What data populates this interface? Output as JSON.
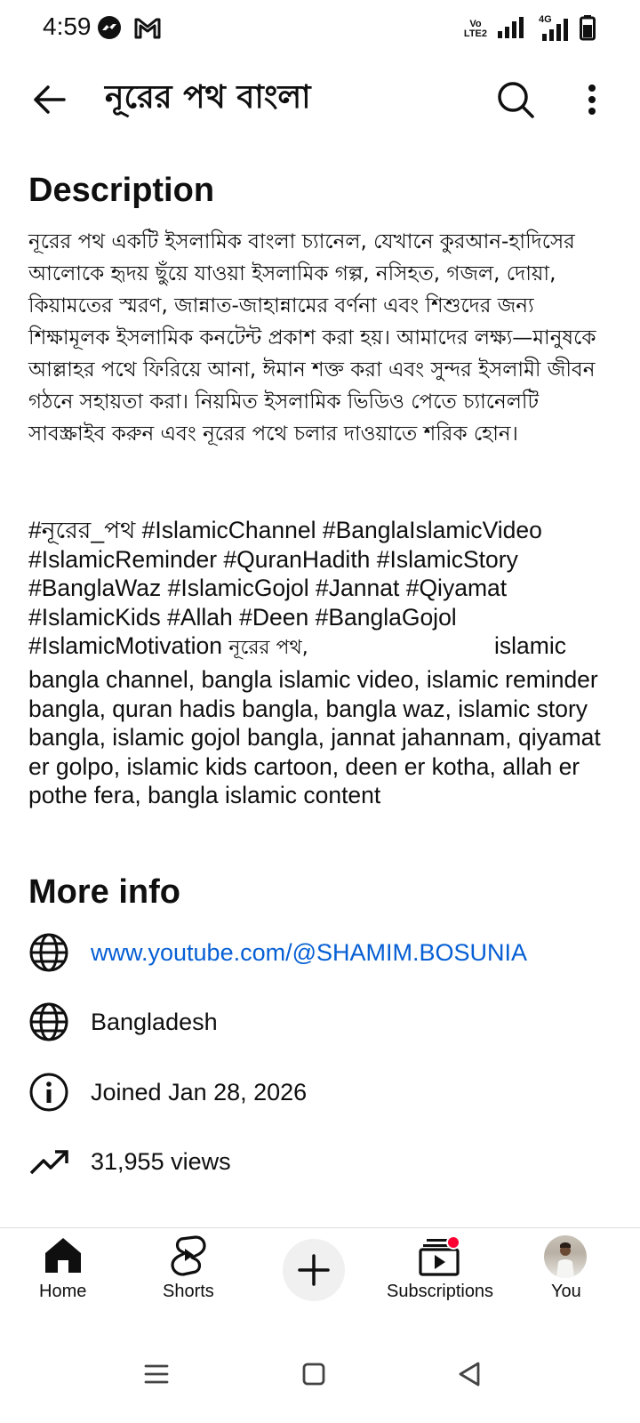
{
  "status_bar": {
    "time": "4:59",
    "volte_line1": "Vo",
    "volte_line2": "LTE2",
    "network_label": "4G"
  },
  "app_bar": {
    "title": "নূরের পথ বাংলা"
  },
  "description": {
    "heading": "Description",
    "bangla_paragraph": "নূরের পথ একটি ইসলামিক বাংলা চ্যানেল, যেখানে কুরআন-হাদিসের আলোকে হৃদয় ছুঁয়ে যাওয়া ইসলামিক গল্প, নসিহত, গজল, দোয়া, কিয়ামতের স্মরণ, জান্নাত-জাহান্নামের বর্ণনা এবং শিশুদের জন্য শিক্ষামূলক ইসলামিক কনটেন্ট প্রকাশ করা হয়। আমাদের লক্ষ্য—মানুষকে আল্লাহর পথে ফিরিয়ে আনা, ঈমান শক্ত করা এবং সুন্দর ইসলামী জীবন গঠনে সহায়তা করা। নিয়মিত ইসলামিক ভিডিও পেতে চ্যানেলটি সাবস্ক্রাইব করুন এবং নূরের পথে চলার দাওয়াতে শরিক হোন।",
    "hashtags_line1": "#নূরের_পথ #IslamicChannel #BanglaIslamicVideo",
    "hashtags_line2": "#IslamicReminder #QuranHadith #IslamicStory",
    "hashtags_line3": "#BanglaWaz #IslamicGojol #Jannat #Qiyamat",
    "hashtags_line4": "#IslamicKids #Allah #Deen #BanglaGojol",
    "hashtags_line5_start": "#IslamicMotivation",
    "hashtags_line5_bn": "নূরের পথ,",
    "hashtags_line5_end": "islamic",
    "keywords": "bangla channel, bangla islamic video, islamic reminder bangla, quran hadis bangla, bangla waz, islamic story bangla, islamic gojol bangla, jannat jahannam, qiyamat er golpo, islamic kids cartoon, deen er kotha, allah er pothe fera, bangla islamic content"
  },
  "more_info": {
    "heading": "More info",
    "link": "www.youtube.com/@SHAMIM.BOSUNIA",
    "country": "Bangladesh",
    "joined": "Joined Jan 28, 2026",
    "views": "31,955 views"
  },
  "bottom_nav": {
    "home": "Home",
    "shorts": "Shorts",
    "subscriptions": "Subscriptions",
    "you": "You"
  },
  "colors": {
    "link": "#065fd4",
    "badge": "#ff0033",
    "text": "#0f0f0f"
  }
}
